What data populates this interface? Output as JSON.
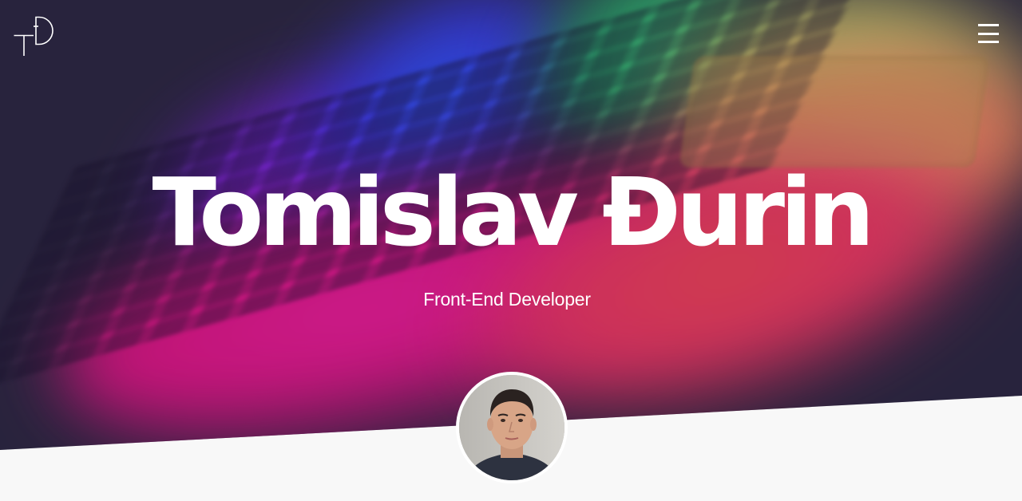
{
  "header": {
    "logo_icon": "td-monogram-logo",
    "menu_icon": "hamburger-menu-icon"
  },
  "hero": {
    "title": "Tomislav Đurin",
    "subtitle": "Front-End Developer",
    "background_image": "blurred-rgb-laptop-keyboard-photo",
    "avatar_image": "profile-photo"
  },
  "colors": {
    "background": "#f8f8f8",
    "hero_dark": "#2b2840",
    "text": "#ffffff"
  }
}
